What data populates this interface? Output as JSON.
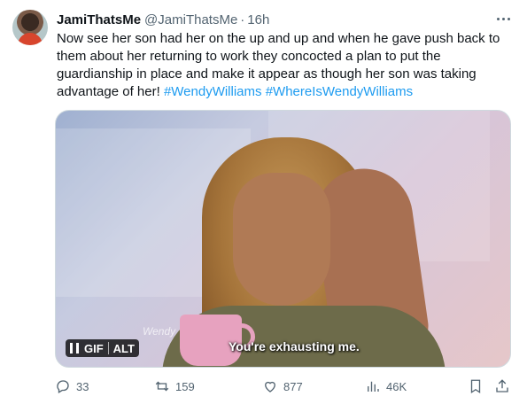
{
  "author": {
    "name": "JamiThatsMe",
    "handle": "@JamiThatsMe",
    "separator": "·",
    "time": "16h"
  },
  "tweet": {
    "text": "Now see her son had her on the up and up and when he gave push back to them about her returning to work they concocted a plan to put the guardianship in place and make it appear as though her son was taking advantage of her!",
    "hashtags": [
      "#WendyWilliams",
      "#WhereIsWendyWilliams"
    ]
  },
  "media": {
    "subtitle": "You're exhausting me.",
    "badge_gif": "GIF",
    "badge_alt": "ALT",
    "watermark": "Wendy"
  },
  "actions": {
    "reply_count": "33",
    "retweet_count": "159",
    "like_count": "877",
    "view_count": "46K"
  },
  "icons": {
    "more": "more-icon",
    "reply": "reply-icon",
    "retweet": "retweet-icon",
    "like": "heart-icon",
    "views": "views-icon",
    "bookmark": "bookmark-icon",
    "share": "share-icon"
  },
  "colors": {
    "accent": "#1d9bf0",
    "text": "#0f1419",
    "secondary": "#536471"
  }
}
